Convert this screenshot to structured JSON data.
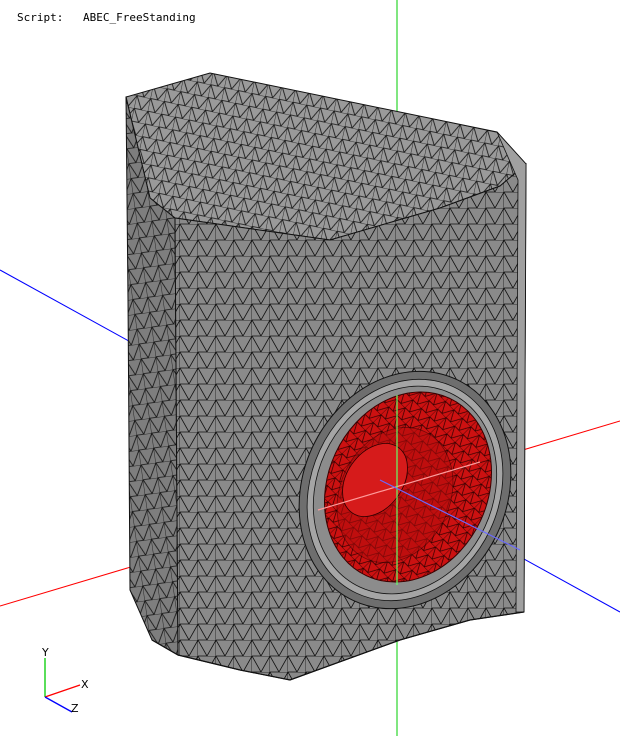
{
  "header": {
    "script_label": "Script:",
    "script_name": "ABEC_FreeStanding"
  },
  "gizmo": {
    "x_label": "X",
    "y_label": "Y",
    "z_label": "Z"
  },
  "colors": {
    "background": "#ffffff",
    "mesh_fill": "#8c8c8c",
    "mesh_edge": "#000000",
    "driver_fill": "#cc1111",
    "axis_x": "#ff0000",
    "axis_y": "#00cc00",
    "axis_z": "#0000ff"
  }
}
